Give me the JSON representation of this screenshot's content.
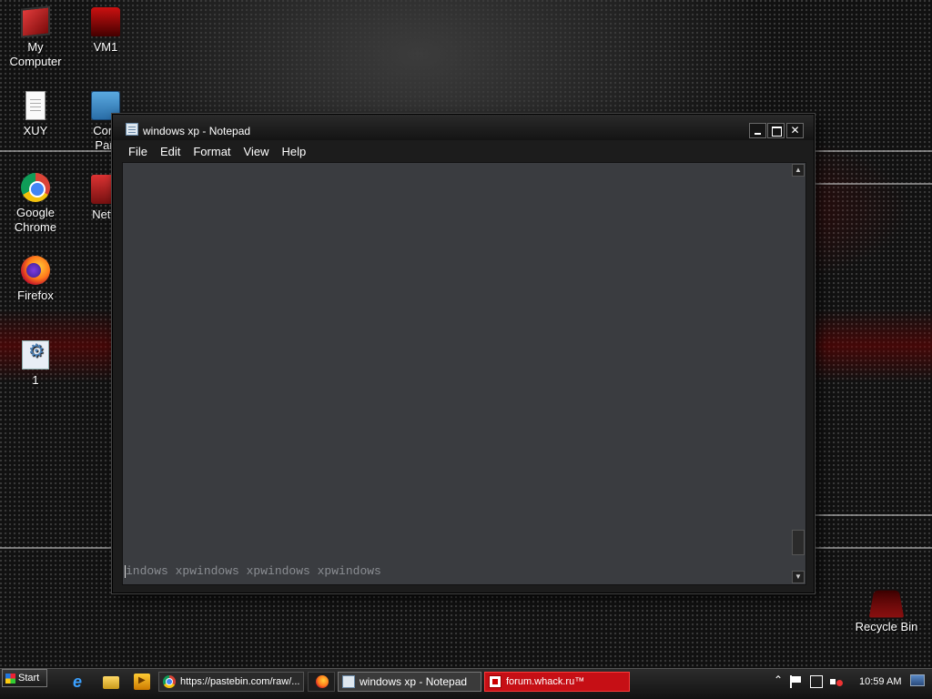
{
  "desktop": {
    "icons": [
      {
        "label": "My\nComputer",
        "icon": "my-computer-icon"
      },
      {
        "label": "VM1",
        "icon": "vm-icon"
      },
      {
        "label": "XUY",
        "icon": "text-file-icon"
      },
      {
        "label": "Cont\nPan",
        "icon": "control-panel-icon"
      },
      {
        "label": "Google\nChrome",
        "icon": "chrome-icon"
      },
      {
        "label": "Netw",
        "icon": "network-icon"
      },
      {
        "label": "Firefox",
        "icon": "firefox-icon"
      },
      {
        "label": "1",
        "icon": "settings-file-icon"
      },
      {
        "label": "Recycle Bin",
        "icon": "recycle-bin-icon"
      }
    ]
  },
  "notepad": {
    "title": "windows xp - Notepad",
    "menu": [
      "File",
      "Edit",
      "Format",
      "View",
      "Help"
    ],
    "content": "windows xpwindows xpwindows xpwindows",
    "content_visible": "indows xpwindows xpwindows xpwindows"
  },
  "taskbar": {
    "start_label": "Start",
    "start_after": "l",
    "tasks": [
      {
        "label": "https://pastebin.com/raw/...",
        "icon": "chrome-icon"
      },
      {
        "label": "",
        "icon": "firefox-icon"
      },
      {
        "label": "windows xp - Notepad",
        "icon": "notepad-icon"
      },
      {
        "label": "forum.whack.ru™",
        "icon": "forum-icon"
      }
    ],
    "clock": "10:59 AM"
  },
  "colors": {
    "forum_task_bg": "#c60f15",
    "editor_bg": "#3a3c40",
    "editor_text": "#8a8d92"
  }
}
